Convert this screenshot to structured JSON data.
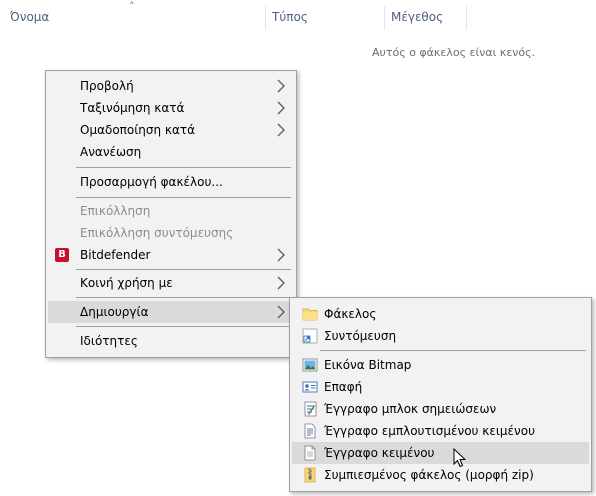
{
  "columns": {
    "name": "Όνομα",
    "type": "Τύπος",
    "size": "Μέγεθος"
  },
  "empty_message": "Αυτός ο φάκελος είναι κενός.",
  "context_menu": {
    "items": [
      {
        "label": "Προβολή",
        "submenu": true,
        "enabled": true
      },
      {
        "label": "Ταξινόμηση κατά",
        "submenu": true,
        "enabled": true
      },
      {
        "label": "Ομαδοποίηση κατά",
        "submenu": true,
        "enabled": true
      },
      {
        "label": "Ανανέωση",
        "submenu": false,
        "enabled": true
      },
      {
        "label": "Προσαρμογή φακέλου...",
        "submenu": false,
        "enabled": true
      },
      {
        "label": "Επικόλληση",
        "submenu": false,
        "enabled": false
      },
      {
        "label": "Επικόλληση συντόμευσης",
        "submenu": false,
        "enabled": false
      },
      {
        "label": "Bitdefender",
        "submenu": true,
        "enabled": true,
        "icon": "bitdefender-icon",
        "icon_letter": "B"
      },
      {
        "label": "Κοινή χρήση με",
        "submenu": true,
        "enabled": true
      },
      {
        "label": "Δημιουργία",
        "submenu": true,
        "enabled": true,
        "highlighted": true
      },
      {
        "label": "Ιδιότητες",
        "submenu": false,
        "enabled": true
      }
    ]
  },
  "new_submenu": {
    "items": [
      {
        "label": "Φάκελος",
        "icon": "folder-icon"
      },
      {
        "label": "Συντόμευση",
        "icon": "shortcut-icon"
      },
      {
        "label": "Εικόνα Bitmap",
        "icon": "bitmap-icon"
      },
      {
        "label": "Επαφή",
        "icon": "contact-icon"
      },
      {
        "label": "Έγγραφο μπλοκ σημειώσεων",
        "icon": "journal-icon"
      },
      {
        "label": "Έγγραφο εμπλουτισμένου κειμένου",
        "icon": "rich-text-icon"
      },
      {
        "label": "Έγγραφο κειμένου",
        "icon": "text-document-icon",
        "highlighted": true
      },
      {
        "label": "Συμπιεσμένος φάκελος (μορφή zip)",
        "icon": "zip-folder-icon"
      }
    ]
  },
  "colors": {
    "menu_bg": "#f2f2f2",
    "highlight": "#dadada",
    "header_text": "#4d6082",
    "disabled_text": "#8d8d8d",
    "bitdefender_red": "#c8102e"
  }
}
